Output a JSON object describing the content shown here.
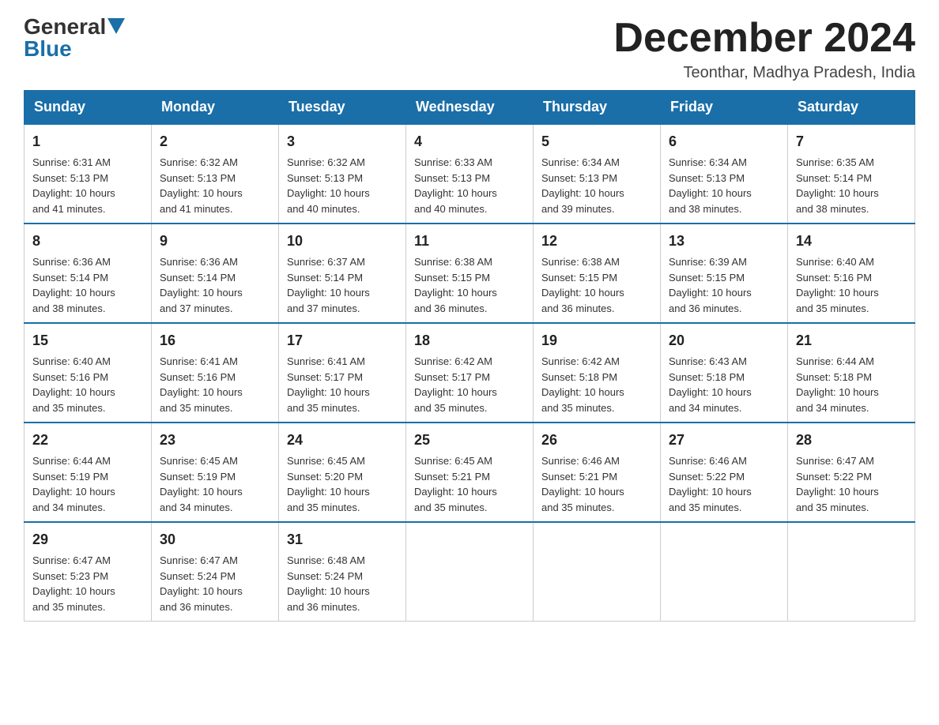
{
  "header": {
    "logo_general": "General",
    "logo_blue": "Blue",
    "month_title": "December 2024",
    "location": "Teonthar, Madhya Pradesh, India"
  },
  "days_of_week": [
    "Sunday",
    "Monday",
    "Tuesday",
    "Wednesday",
    "Thursday",
    "Friday",
    "Saturday"
  ],
  "weeks": [
    [
      {
        "day": "1",
        "sunrise": "6:31 AM",
        "sunset": "5:13 PM",
        "daylight": "10 hours and 41 minutes."
      },
      {
        "day": "2",
        "sunrise": "6:32 AM",
        "sunset": "5:13 PM",
        "daylight": "10 hours and 41 minutes."
      },
      {
        "day": "3",
        "sunrise": "6:32 AM",
        "sunset": "5:13 PM",
        "daylight": "10 hours and 40 minutes."
      },
      {
        "day": "4",
        "sunrise": "6:33 AM",
        "sunset": "5:13 PM",
        "daylight": "10 hours and 40 minutes."
      },
      {
        "day": "5",
        "sunrise": "6:34 AM",
        "sunset": "5:13 PM",
        "daylight": "10 hours and 39 minutes."
      },
      {
        "day": "6",
        "sunrise": "6:34 AM",
        "sunset": "5:13 PM",
        "daylight": "10 hours and 38 minutes."
      },
      {
        "day": "7",
        "sunrise": "6:35 AM",
        "sunset": "5:14 PM",
        "daylight": "10 hours and 38 minutes."
      }
    ],
    [
      {
        "day": "8",
        "sunrise": "6:36 AM",
        "sunset": "5:14 PM",
        "daylight": "10 hours and 38 minutes."
      },
      {
        "day": "9",
        "sunrise": "6:36 AM",
        "sunset": "5:14 PM",
        "daylight": "10 hours and 37 minutes."
      },
      {
        "day": "10",
        "sunrise": "6:37 AM",
        "sunset": "5:14 PM",
        "daylight": "10 hours and 37 minutes."
      },
      {
        "day": "11",
        "sunrise": "6:38 AM",
        "sunset": "5:15 PM",
        "daylight": "10 hours and 36 minutes."
      },
      {
        "day": "12",
        "sunrise": "6:38 AM",
        "sunset": "5:15 PM",
        "daylight": "10 hours and 36 minutes."
      },
      {
        "day": "13",
        "sunrise": "6:39 AM",
        "sunset": "5:15 PM",
        "daylight": "10 hours and 36 minutes."
      },
      {
        "day": "14",
        "sunrise": "6:40 AM",
        "sunset": "5:16 PM",
        "daylight": "10 hours and 35 minutes."
      }
    ],
    [
      {
        "day": "15",
        "sunrise": "6:40 AM",
        "sunset": "5:16 PM",
        "daylight": "10 hours and 35 minutes."
      },
      {
        "day": "16",
        "sunrise": "6:41 AM",
        "sunset": "5:16 PM",
        "daylight": "10 hours and 35 minutes."
      },
      {
        "day": "17",
        "sunrise": "6:41 AM",
        "sunset": "5:17 PM",
        "daylight": "10 hours and 35 minutes."
      },
      {
        "day": "18",
        "sunrise": "6:42 AM",
        "sunset": "5:17 PM",
        "daylight": "10 hours and 35 minutes."
      },
      {
        "day": "19",
        "sunrise": "6:42 AM",
        "sunset": "5:18 PM",
        "daylight": "10 hours and 35 minutes."
      },
      {
        "day": "20",
        "sunrise": "6:43 AM",
        "sunset": "5:18 PM",
        "daylight": "10 hours and 34 minutes."
      },
      {
        "day": "21",
        "sunrise": "6:44 AM",
        "sunset": "5:18 PM",
        "daylight": "10 hours and 34 minutes."
      }
    ],
    [
      {
        "day": "22",
        "sunrise": "6:44 AM",
        "sunset": "5:19 PM",
        "daylight": "10 hours and 34 minutes."
      },
      {
        "day": "23",
        "sunrise": "6:45 AM",
        "sunset": "5:19 PM",
        "daylight": "10 hours and 34 minutes."
      },
      {
        "day": "24",
        "sunrise": "6:45 AM",
        "sunset": "5:20 PM",
        "daylight": "10 hours and 35 minutes."
      },
      {
        "day": "25",
        "sunrise": "6:45 AM",
        "sunset": "5:21 PM",
        "daylight": "10 hours and 35 minutes."
      },
      {
        "day": "26",
        "sunrise": "6:46 AM",
        "sunset": "5:21 PM",
        "daylight": "10 hours and 35 minutes."
      },
      {
        "day": "27",
        "sunrise": "6:46 AM",
        "sunset": "5:22 PM",
        "daylight": "10 hours and 35 minutes."
      },
      {
        "day": "28",
        "sunrise": "6:47 AM",
        "sunset": "5:22 PM",
        "daylight": "10 hours and 35 minutes."
      }
    ],
    [
      {
        "day": "29",
        "sunrise": "6:47 AM",
        "sunset": "5:23 PM",
        "daylight": "10 hours and 35 minutes."
      },
      {
        "day": "30",
        "sunrise": "6:47 AM",
        "sunset": "5:24 PM",
        "daylight": "10 hours and 36 minutes."
      },
      {
        "day": "31",
        "sunrise": "6:48 AM",
        "sunset": "5:24 PM",
        "daylight": "10 hours and 36 minutes."
      },
      null,
      null,
      null,
      null
    ]
  ],
  "labels": {
    "sunrise": "Sunrise:",
    "sunset": "Sunset:",
    "daylight": "Daylight:"
  }
}
